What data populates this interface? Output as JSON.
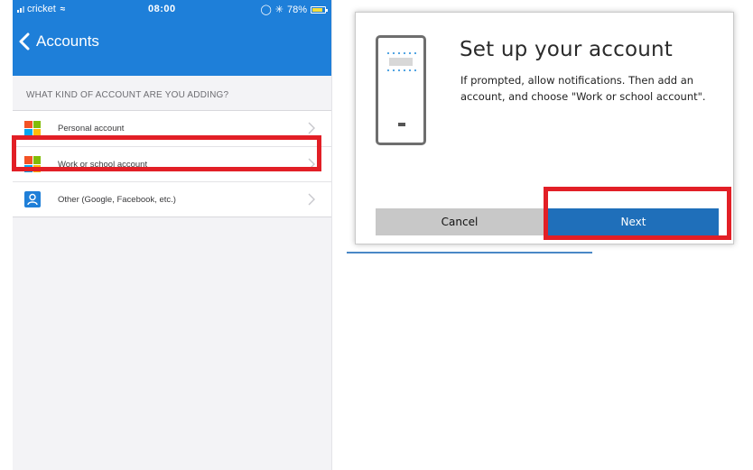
{
  "phone": {
    "status_bar": {
      "carrier": "cricket",
      "time": "08:00",
      "battery_text": "78%",
      "icons": [
        "signal-icon",
        "wifi-icon",
        "location-icon",
        "bluetooth-icon",
        "battery-icon"
      ]
    },
    "nav": {
      "back_label": "Accounts"
    },
    "section_header": "WHAT KIND OF ACCOUNT ARE YOU ADDING?",
    "accounts": [
      {
        "label": "Personal account",
        "icon": "microsoft-logo-icon"
      },
      {
        "label": "Work or school account",
        "icon": "microsoft-logo-icon",
        "highlighted": true
      },
      {
        "label": "Other (Google, Facebook, etc.)",
        "icon": "person-icon"
      }
    ]
  },
  "dialog": {
    "title": "Set up your account",
    "body": "If prompted, allow notifications. Then add an account, and choose \"Work or school account\".",
    "cancel_label": "Cancel",
    "next_label": "Next",
    "illustration_icon": "phone-icon"
  },
  "colors": {
    "ios_blue": "#1e7fd9",
    "highlight_red": "#e21f26",
    "next_blue": "#1f6fba",
    "cancel_gray": "#c8c8c8"
  }
}
